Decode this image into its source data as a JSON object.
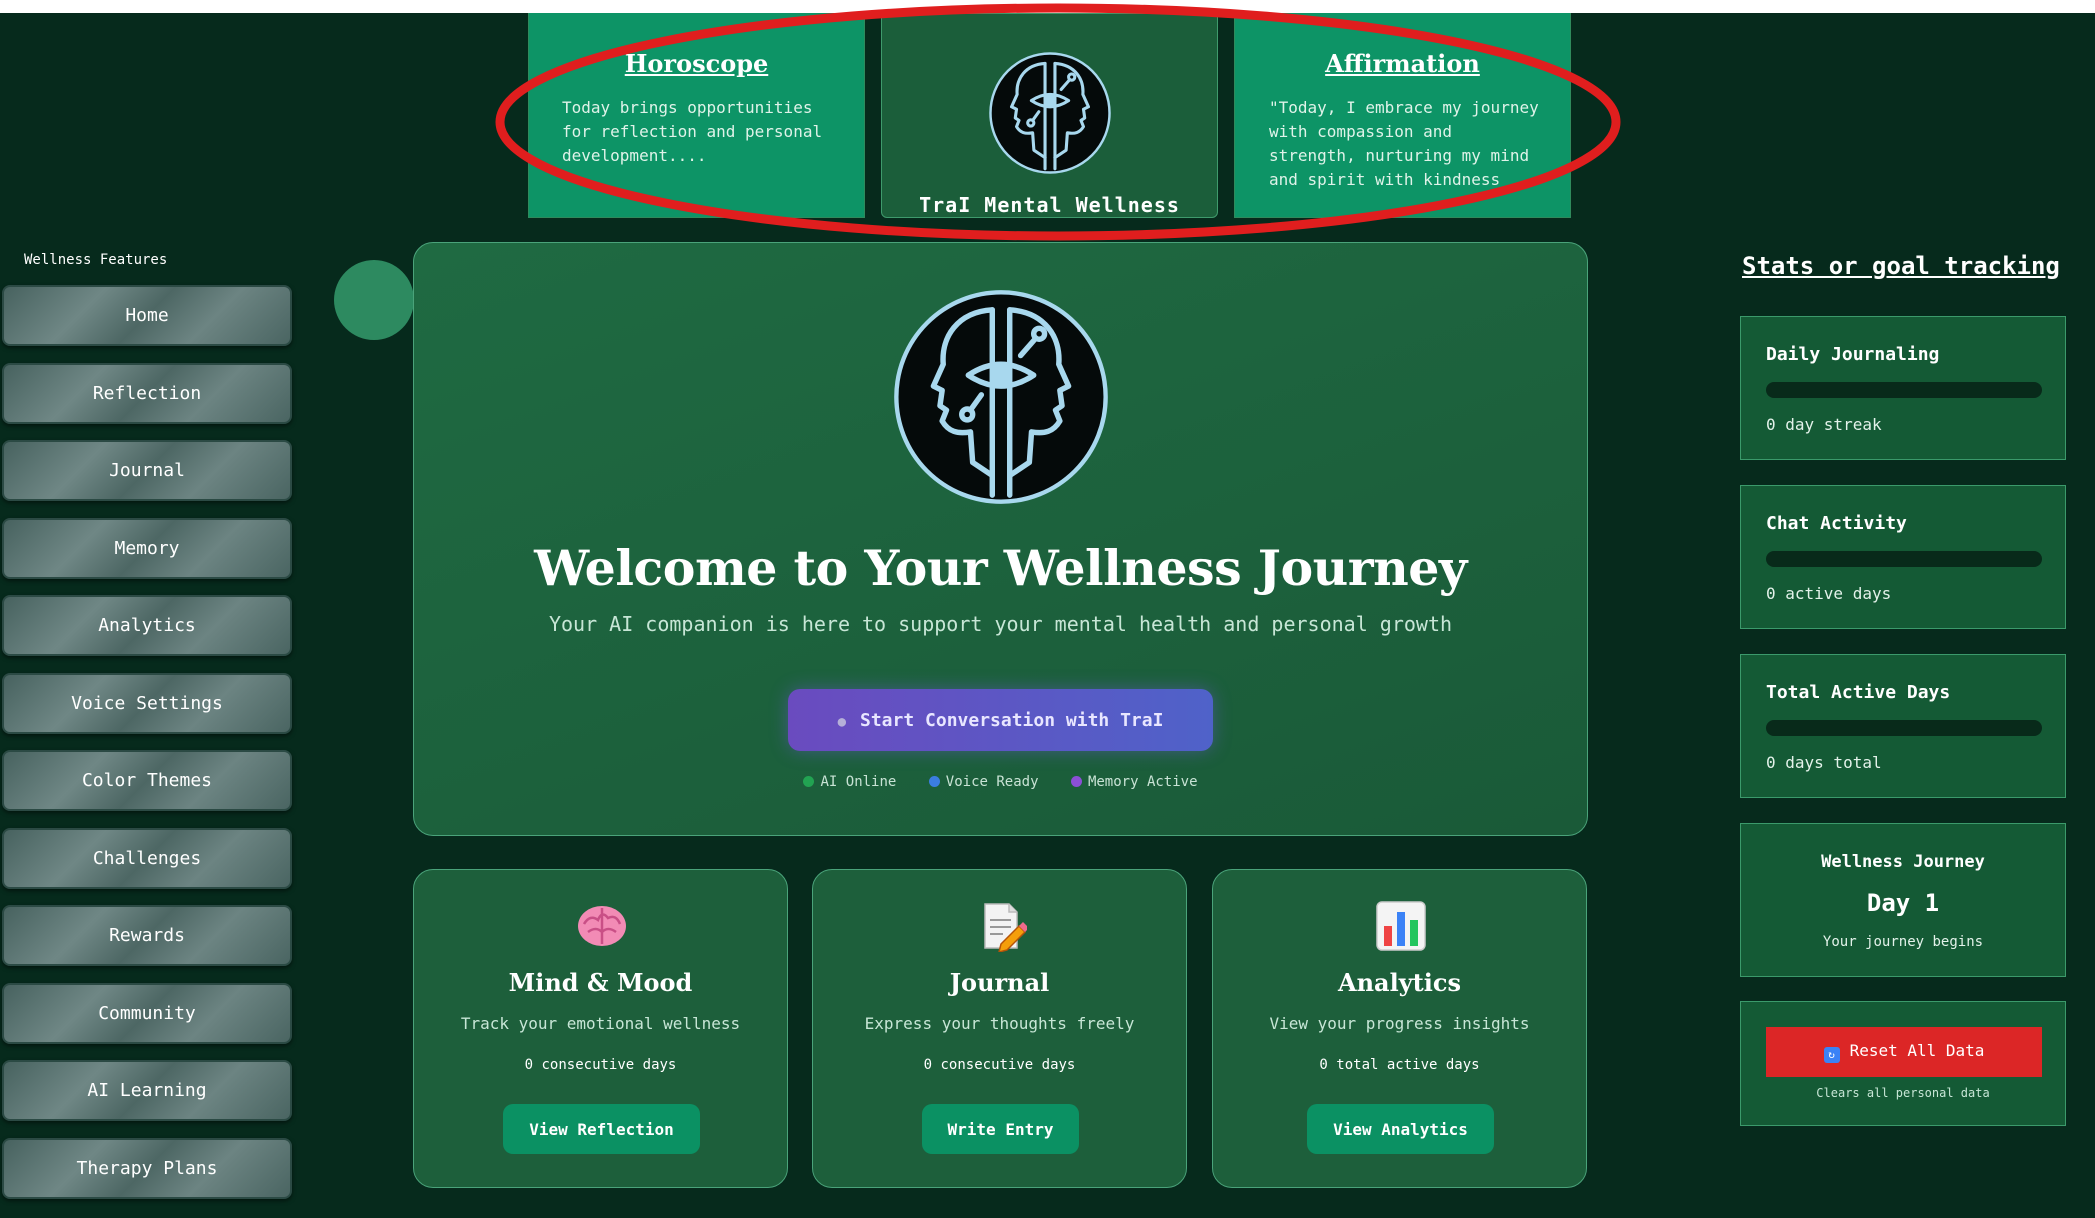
{
  "top_cards": {
    "horoscope": {
      "title": "Horoscope",
      "text": "Today brings opportunities for reflection and personal development...."
    },
    "center": {
      "brand": "TraI Mental Wellness",
      "logo_icon": "dual-face-eye-logo-icon"
    },
    "affirmation": {
      "title": "Affirmation",
      "text": "\"Today, I embrace my journey with compassion and strength, nurturing my mind and spirit with kindness"
    }
  },
  "sidebar": {
    "title": "Wellness Features",
    "items": [
      {
        "label": "Home"
      },
      {
        "label": "Reflection"
      },
      {
        "label": "Journal"
      },
      {
        "label": "Memory"
      },
      {
        "label": "Analytics"
      },
      {
        "label": "Voice Settings"
      },
      {
        "label": "Color Themes"
      },
      {
        "label": "Challenges"
      },
      {
        "label": "Rewards"
      },
      {
        "label": "Community"
      },
      {
        "label": "AI Learning"
      },
      {
        "label": "Therapy Plans"
      }
    ]
  },
  "welcome": {
    "heading": "Welcome to Your Wellness Journey",
    "subtitle": "Your AI companion is here to support your mental health and personal growth",
    "start_button": "Start Conversation with TraI",
    "start_icon": "speech-bubble-icon",
    "status": [
      {
        "label": "AI Online",
        "color": "#22a352"
      },
      {
        "label": "Voice Ready",
        "color": "#3b7de0"
      },
      {
        "label": "Memory Active",
        "color": "#8b4fd6"
      }
    ]
  },
  "features": [
    {
      "icon": "brain-icon",
      "title": "Mind & Mood",
      "desc": "Track your emotional wellness",
      "stat": "0 consecutive days",
      "button": "View Reflection"
    },
    {
      "icon": "memo-pencil-icon",
      "title": "Journal",
      "desc": "Express your thoughts freely",
      "stat": "0 consecutive days",
      "button": "Write Entry"
    },
    {
      "icon": "bar-chart-icon",
      "title": "Analytics",
      "desc": "View your progress insights",
      "stat": "0 total active days",
      "button": "View Analytics"
    }
  ],
  "stats": {
    "title": "Stats or goal tracking",
    "boxes": [
      {
        "title": "Daily Journaling",
        "value": "0 day streak",
        "progress": 0
      },
      {
        "title": "Chat Activity",
        "value": "0 active days",
        "progress": 0
      },
      {
        "title": "Total Active Days",
        "value": "0 days total",
        "progress": 0
      }
    ],
    "journey": {
      "title": "Wellness Journey",
      "day": "Day 1",
      "sub": "Your journey begins"
    },
    "reset": {
      "button": "Reset All Data",
      "icon": "refresh-icon",
      "note": "Clears all personal data"
    }
  },
  "colors": {
    "background": "#062a1c",
    "accent_green": "#0b9163",
    "reset_red": "#dc2626",
    "highlight_ellipse": "#e01e1e"
  }
}
